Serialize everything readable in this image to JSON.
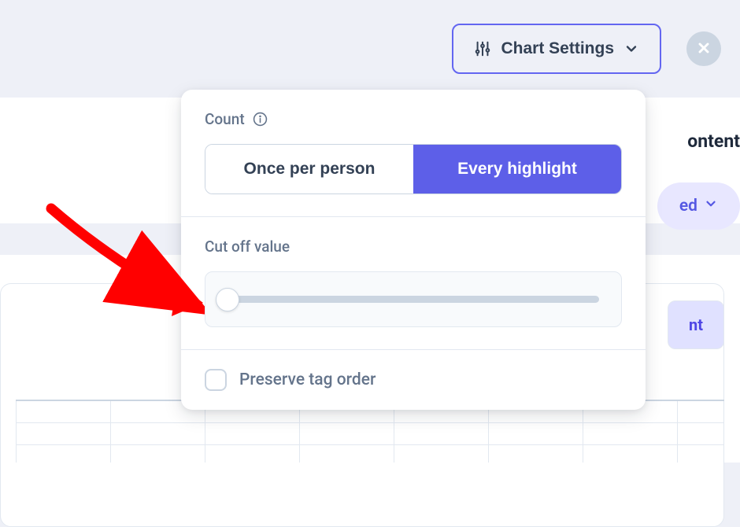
{
  "topbar": {
    "chart_settings_label": "Chart Settings"
  },
  "partial": {
    "tab_text": "ontent",
    "pill_text": "ed",
    "badge_text": "nt"
  },
  "popover": {
    "count": {
      "label": "Count",
      "option_once": "Once per person",
      "option_every": "Every highlight"
    },
    "cutoff": {
      "label": "Cut off value"
    },
    "preserve": {
      "label": "Preserve tag order"
    }
  }
}
